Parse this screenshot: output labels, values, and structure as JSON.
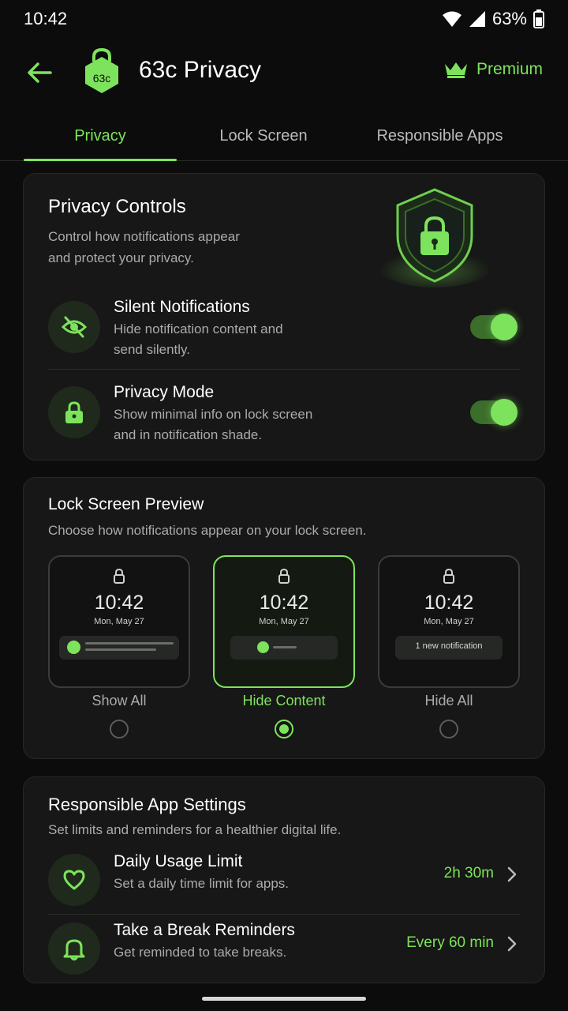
{
  "status": {
    "time": "10:42",
    "battery": "63%"
  },
  "app": {
    "title": "63c Privacy",
    "logo_text": "63c",
    "premium_label": "Premium"
  },
  "tabs": [
    {
      "label": "Privacy"
    },
    {
      "label": "Lock Screen"
    },
    {
      "label": "Responsible Apps"
    }
  ],
  "privacy_controls": {
    "title": "Privacy Controls",
    "desc_line1": "Control how notifications appear",
    "desc_line2": "and protect your privacy.",
    "items": [
      {
        "title": "Silent Notifications",
        "desc_line1": "Hide notification content and",
        "desc_line2": "send silently.",
        "enabled": true
      },
      {
        "title": "Privacy Mode",
        "desc_line1": "Show minimal info on lock screen",
        "desc_line2": "and in notification shade.",
        "enabled": true
      }
    ]
  },
  "lock_preview": {
    "title": "Lock Screen Preview",
    "desc": "Choose how notifications appear on your lock screen.",
    "options": [
      {
        "label": "Show All",
        "time": "10:42",
        "date": "Mon, May 27",
        "selected": false
      },
      {
        "label": "Hide Content",
        "time": "10:42",
        "date": "Mon, May 27",
        "selected": true
      },
      {
        "label": "Hide All",
        "time": "10:42",
        "date": "Mon, May 27",
        "notification_text": "1 new notification",
        "selected": false
      }
    ]
  },
  "responsible": {
    "title": "Responsible App Settings",
    "desc": "Set limits and reminders for a healthier digital life.",
    "items": [
      {
        "title": "Daily Usage Limit",
        "desc": "Set a daily time limit for apps.",
        "value": "2h 30m"
      },
      {
        "title": "Take a Break Reminders",
        "desc": "Get reminded to take breaks.",
        "value": "Every 60 min"
      }
    ]
  },
  "colors": {
    "accent": "#7ee35c",
    "background": "#0b0c0b",
    "card": "#161716"
  }
}
